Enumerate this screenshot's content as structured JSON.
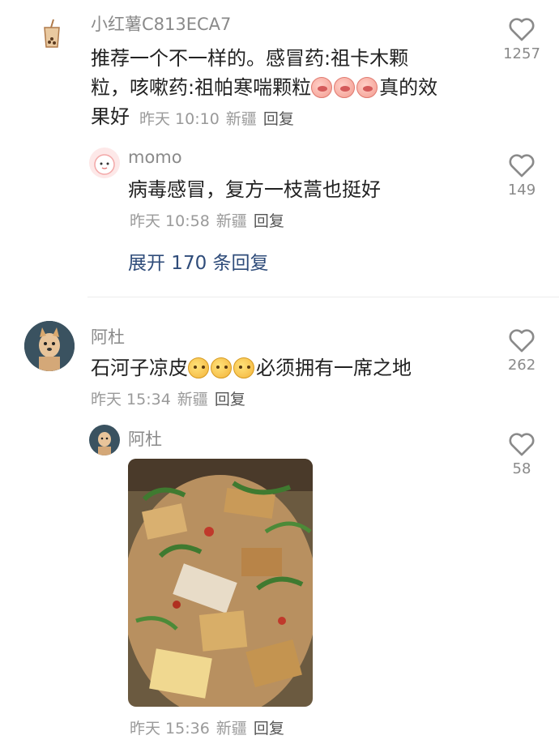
{
  "comments": [
    {
      "user": "小红薯C813ECA7",
      "text_line1": "推荐一个不一样的。感冒药:祖卡木颗",
      "text_line2a": "粒，咳嗽药:祖帕寒喘颗粒",
      "text_line2b": "真的效",
      "text_line3": "果好",
      "time": "昨天 10:10",
      "location": "新疆",
      "reply": "回复",
      "likes": "1257"
    },
    {
      "user": "momo",
      "text": "病毒感冒，复方一枝蒿也挺好",
      "time": "昨天 10:58",
      "location": "新疆",
      "reply": "回复",
      "likes": "149"
    },
    {
      "expand": "展开 170 条回复"
    },
    {
      "user": "阿杜",
      "text_a": "石河子凉皮",
      "text_b": "必须拥有一席之地",
      "time": "昨天 15:34",
      "location": "新疆",
      "reply": "回复",
      "likes": "262"
    },
    {
      "user": "阿杜",
      "time": "昨天 15:36",
      "location": "新疆",
      "reply": "回复",
      "likes": "58"
    }
  ],
  "icons": {
    "like": "heart-outline-icon",
    "emoji_peach": "peach-emoji-icon",
    "emoji_yellow": "mango-emoji-icon"
  },
  "colors": {
    "link": "#2f4c7a",
    "meta": "#9a9a9a",
    "text": "#222222"
  }
}
